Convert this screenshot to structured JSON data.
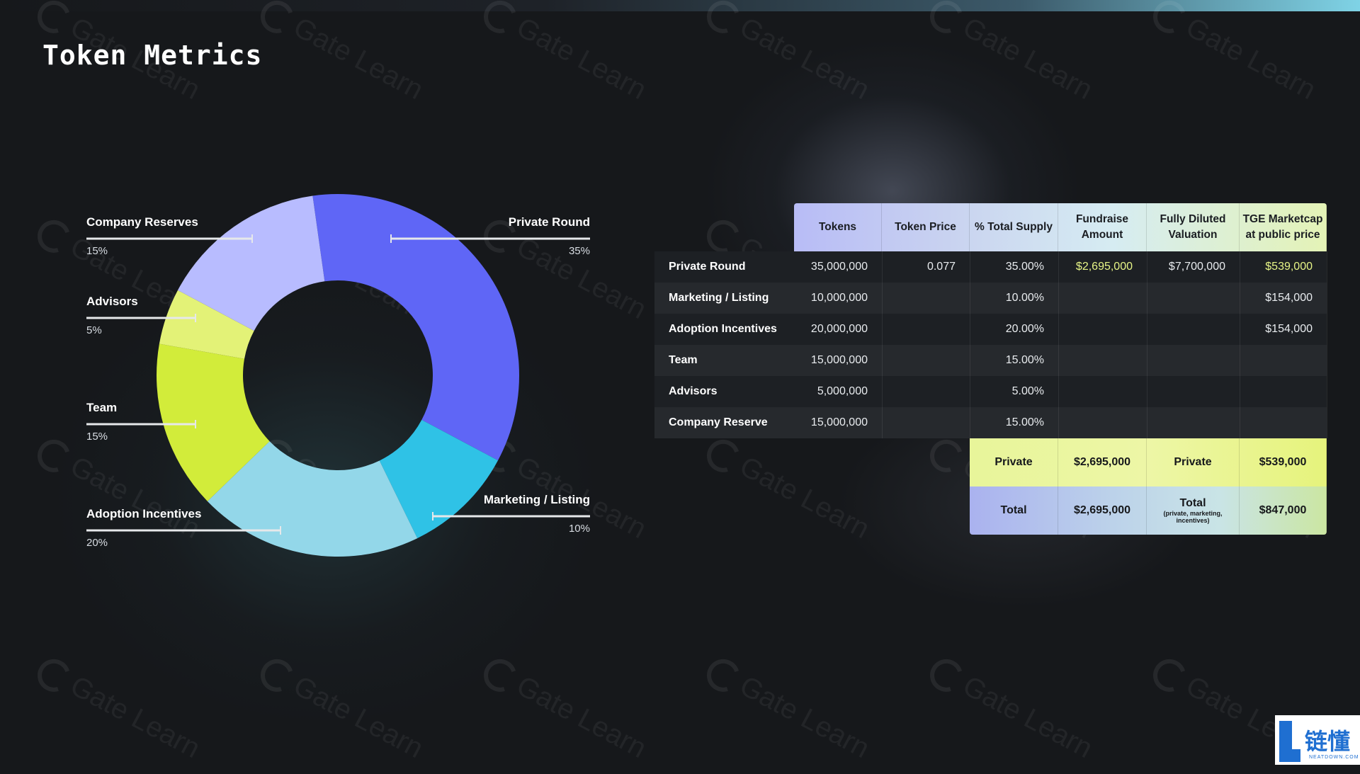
{
  "title": "Token Metrics",
  "watermark_text": "Gate Learn",
  "colors": {
    "private_round": "#5f66f6",
    "marketing_listing": "#2fc2e6",
    "adoption_incentives": "#93d7e9",
    "team": "#d2ec3a",
    "advisors": "#e3f277",
    "company_reserves": "#b8bcff",
    "background": "#16181b"
  },
  "chart_data": {
    "type": "pie",
    "donut": true,
    "slices": [
      {
        "label": "Private Round",
        "value": 35,
        "pct_label": "35%",
        "color": "#5f66f6"
      },
      {
        "label": "Marketing / Listing",
        "value": 10,
        "pct_label": "10%",
        "color": "#2fc2e6"
      },
      {
        "label": "Adoption Incentives",
        "value": 20,
        "pct_label": "20%",
        "color": "#93d7e9"
      },
      {
        "label": "Team",
        "value": 15,
        "pct_label": "15%",
        "color": "#d2ec3a"
      },
      {
        "label": "Advisors",
        "value": 5,
        "pct_label": "5%",
        "color": "#e3f277"
      },
      {
        "label": "Company Reserves",
        "value": 15,
        "pct_label": "15%",
        "color": "#b8bcff"
      }
    ]
  },
  "table": {
    "headers": [
      "Tokens",
      "Token Price",
      "% Total Supply",
      "Fundraise Amount",
      "Fully Diluted Valuation",
      "TGE Marketcap at public price"
    ],
    "rows": [
      {
        "name": "Private Round",
        "tokens": "35,000,000",
        "price": "0.077",
        "supply": "35.00%",
        "fundraise": "$2,695,000",
        "fdv": "$7,700,000",
        "tge": "$539,000"
      },
      {
        "name": "Marketing / Listing",
        "tokens": "10,000,000",
        "price": "",
        "supply": "10.00%",
        "fundraise": "",
        "fdv": "",
        "tge": "$154,000"
      },
      {
        "name": "Adoption Incentives",
        "tokens": "20,000,000",
        "price": "",
        "supply": "20.00%",
        "fundraise": "",
        "fdv": "",
        "tge": "$154,000"
      },
      {
        "name": "Team",
        "tokens": "15,000,000",
        "price": "",
        "supply": "15.00%",
        "fundraise": "",
        "fdv": "",
        "tge": ""
      },
      {
        "name": "Advisors",
        "tokens": "5,000,000",
        "price": "",
        "supply": "5.00%",
        "fundraise": "",
        "fdv": "",
        "tge": ""
      },
      {
        "name": "Company Reserve",
        "tokens": "15,000,000",
        "price": "",
        "supply": "15.00%",
        "fundraise": "",
        "fdv": "",
        "tge": ""
      }
    ],
    "summary": [
      {
        "label": "Private",
        "fundraise": "$2,695,000",
        "fdv_label": "Private",
        "fdv_sub": "",
        "tge": "$539,000"
      },
      {
        "label": "Total",
        "fundraise": "$2,695,000",
        "fdv_label": "Total",
        "fdv_sub": "(private, marketing, incentives)",
        "tge": "$847,000"
      }
    ]
  },
  "logo": {
    "cn": "链懂",
    "en": "NEATDOWN.COM"
  }
}
